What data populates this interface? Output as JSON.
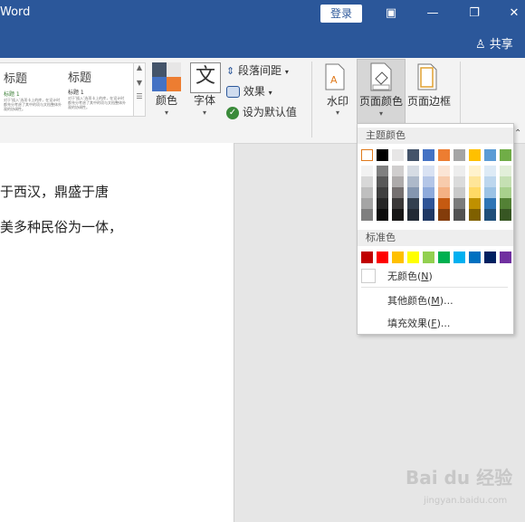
{
  "titlebar": {
    "app_title": "Word",
    "login_label": "登录",
    "share_label": "共享",
    "share_icon": "person-icon",
    "window_buttons": [
      "restore-ribbon-icon",
      "minimize-icon",
      "restore-icon",
      "close-icon"
    ]
  },
  "ribbon": {
    "style_gallery": [
      {
        "heading": "标题",
        "sub": "标题 1",
        "body": "对于'插入'选项卡上的库，在设计时都充分考虑了其中的项与文档整体外观的协调性。"
      },
      {
        "heading": "标题",
        "sub": "标题 1",
        "body": "对于'插入'选项卡上的库，在设计时都充分考虑了其中的项与文档整体外观的协调性。"
      }
    ],
    "colors_label": "颜色",
    "fonts_label": "字体",
    "fonts_glyph": "文",
    "paragraph_spacing_label": "段落间距",
    "effects_label": "效果",
    "set_default_label": "设为默认值",
    "watermark_label": "水印",
    "page_color_label": "页面颜色",
    "page_border_label": "页面边框",
    "accent": "#2b579a"
  },
  "document": {
    "lines": [
      "于西汉，鼎盛于唐",
      "美多种民俗为一体，"
    ]
  },
  "dropdown": {
    "theme_colors_label": "主题颜色",
    "standard_colors_label": "标准色",
    "no_color_label": "无颜色(",
    "no_color_key": "N",
    "more_colors_label": "其他颜色(",
    "more_colors_key": "M",
    "fill_effects_label": "填充效果(",
    "fill_effects_key": "F",
    "close_paren": ")",
    "ellipsis": ")...",
    "theme_top_row": [
      "#ffffff",
      "#000000",
      "#e7e6e6",
      "#44546a",
      "#4472c4",
      "#ed7d31",
      "#a5a5a5",
      "#ffc000",
      "#5b9bd5",
      "#70ad47"
    ],
    "theme_shades": [
      [
        "#f2f2f2",
        "#808080",
        "#d0cece",
        "#d6dce4",
        "#d9e2f3",
        "#fbe5d5",
        "#ededed",
        "#fff2cc",
        "#deebf6",
        "#e2efd9"
      ],
      [
        "#d8d8d8",
        "#595959",
        "#aeabab",
        "#adb9ca",
        "#b4c6e7",
        "#f7cbac",
        "#dbdbdb",
        "#fee599",
        "#bdd7ee",
        "#c5e0b3"
      ],
      [
        "#bfbfbf",
        "#3f3f3f",
        "#757070",
        "#8496b0",
        "#8eaadb",
        "#f4b183",
        "#c9c9c9",
        "#ffd965",
        "#9cc3e5",
        "#a8d08d"
      ],
      [
        "#a5a5a5",
        "#262626",
        "#3a3838",
        "#323f4f",
        "#2f5496",
        "#c55a11",
        "#7b7b7b",
        "#bf9000",
        "#2e75b5",
        "#538135"
      ],
      [
        "#7f7f7f",
        "#0c0c0c",
        "#171616",
        "#222a35",
        "#1f3864",
        "#833c0b",
        "#525252",
        "#7f6000",
        "#1e4e79",
        "#375623"
      ]
    ],
    "standard_colors": [
      "#c00000",
      "#ff0000",
      "#ffc000",
      "#ffff00",
      "#92d050",
      "#00b050",
      "#00b0f0",
      "#0070c0",
      "#002060",
      "#7030a0"
    ]
  },
  "watermark": {
    "text": "Bai du 经验",
    "url": "jingyan.baidu.com"
  }
}
